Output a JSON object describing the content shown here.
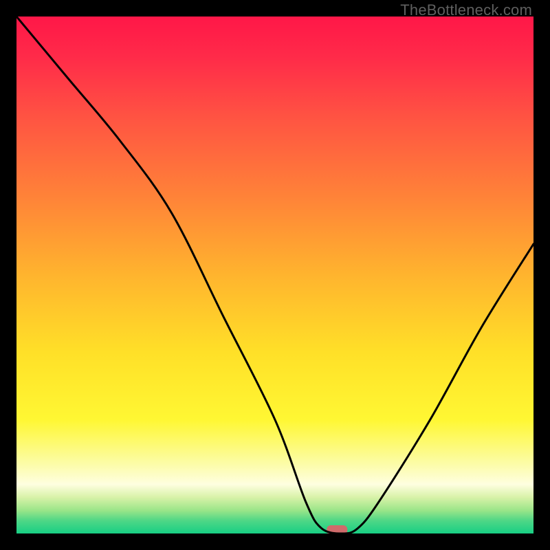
{
  "watermark": "TheBottleneck.com",
  "chart_data": {
    "type": "line",
    "title": "",
    "xlabel": "",
    "ylabel": "",
    "xlim": [
      0,
      100
    ],
    "ylim": [
      0,
      100
    ],
    "grid": false,
    "legend": false,
    "series": [
      {
        "name": "bottleneck-curve",
        "x": [
          0,
          10,
          20,
          30,
          40,
          50,
          56,
          59,
          63,
          66,
          70,
          80,
          90,
          100
        ],
        "values": [
          100,
          88,
          76,
          62,
          42,
          22,
          6,
          1,
          0,
          1,
          6,
          22,
          40,
          56
        ]
      }
    ],
    "marker": {
      "x": 62,
      "y": 0,
      "width_pct": 4,
      "color": "#cf6b6b"
    },
    "gradient_stops": [
      {
        "offset": 0.0,
        "color": "#ff1748"
      },
      {
        "offset": 0.08,
        "color": "#ff2b49"
      },
      {
        "offset": 0.2,
        "color": "#ff5542"
      },
      {
        "offset": 0.35,
        "color": "#ff8338"
      },
      {
        "offset": 0.5,
        "color": "#ffb42e"
      },
      {
        "offset": 0.65,
        "color": "#ffe028"
      },
      {
        "offset": 0.78,
        "color": "#fff733"
      },
      {
        "offset": 0.86,
        "color": "#fcfca0"
      },
      {
        "offset": 0.905,
        "color": "#fefee0"
      },
      {
        "offset": 0.93,
        "color": "#d8f2a8"
      },
      {
        "offset": 0.955,
        "color": "#9be589"
      },
      {
        "offset": 0.975,
        "color": "#4fd786"
      },
      {
        "offset": 1.0,
        "color": "#17cf84"
      }
    ]
  }
}
